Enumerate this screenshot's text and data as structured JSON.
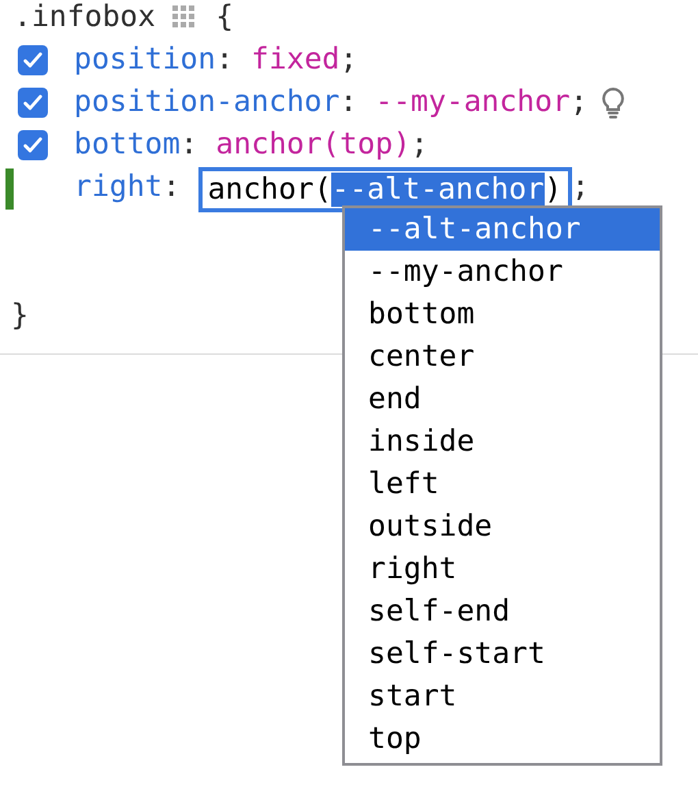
{
  "selector": ".infobox",
  "open_brace": "{",
  "declarations": [
    {
      "property": "position",
      "colon": ":",
      "value": "fixed",
      "semicolon": ";",
      "checked": true,
      "hint": false
    },
    {
      "property": "position-anchor",
      "colon": ":",
      "value": "--my-anchor",
      "semicolon": ";",
      "checked": true,
      "hint": true
    },
    {
      "property": "bottom",
      "colon": ":",
      "value": "anchor(top)",
      "semicolon": ";",
      "checked": true,
      "hint": false
    }
  ],
  "editing": {
    "property": "right",
    "colon": ":",
    "value_before": "anchor(",
    "value_selected": "--alt-anchor",
    "value_after": ")",
    "semicolon": ";"
  },
  "close_brace": "}",
  "autocomplete": [
    {
      "label": "--alt-anchor",
      "selected": true
    },
    {
      "label": "--my-anchor",
      "selected": false
    },
    {
      "label": "bottom",
      "selected": false
    },
    {
      "label": "center",
      "selected": false
    },
    {
      "label": "end",
      "selected": false
    },
    {
      "label": "inside",
      "selected": false
    },
    {
      "label": "left",
      "selected": false
    },
    {
      "label": "outside",
      "selected": false
    },
    {
      "label": "right",
      "selected": false
    },
    {
      "label": "self-end",
      "selected": false
    },
    {
      "label": "self-start",
      "selected": false
    },
    {
      "label": "start",
      "selected": false
    },
    {
      "label": "top",
      "selected": false
    }
  ]
}
